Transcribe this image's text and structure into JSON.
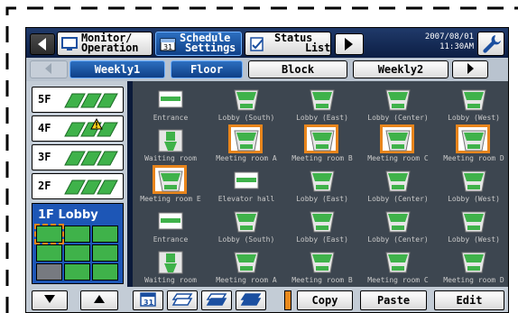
{
  "header": {
    "nav_left": "back",
    "buttons": [
      {
        "line1": "Monitor/",
        "line2": "Operation",
        "icon": "monitor-icon"
      },
      {
        "line1": "Schedule",
        "line2": "Settings",
        "icon": "calendar-icon"
      },
      {
        "line1": "Status",
        "line2": "List",
        "icon": "checklist-icon"
      }
    ],
    "date": "2007/08/01",
    "time": "11:30AM"
  },
  "tabs": [
    {
      "label": "Weekly1",
      "active": true
    },
    {
      "label": "Floor",
      "active": true
    },
    {
      "label": "Block",
      "active": false
    },
    {
      "label": "Weekly2",
      "active": false
    }
  ],
  "floors": [
    {
      "label": "5F",
      "warning": false
    },
    {
      "label": "4F",
      "warning": true
    },
    {
      "label": "3F",
      "warning": false
    },
    {
      "label": "2F",
      "warning": false
    },
    {
      "label": "1F Lobby",
      "selected": true
    }
  ],
  "units": [
    {
      "label": "Entrance",
      "kind": "flat",
      "selected": false
    },
    {
      "label": "Lobby (South)",
      "kind": "ceiling",
      "selected": false
    },
    {
      "label": "Lobby (East)",
      "kind": "ceiling",
      "selected": false
    },
    {
      "label": "Lobby (Center)",
      "kind": "ceiling",
      "selected": false
    },
    {
      "label": "Lobby (West)",
      "kind": "ceiling",
      "selected": false
    },
    {
      "label": "Waiting room",
      "kind": "wall",
      "selected": false
    },
    {
      "label": "Meeting room A",
      "kind": "ceiling",
      "selected": true
    },
    {
      "label": "Meeting room B",
      "kind": "ceiling",
      "selected": true
    },
    {
      "label": "Meeting room C",
      "kind": "ceiling",
      "selected": true
    },
    {
      "label": "Meeting room D",
      "kind": "ceiling",
      "selected": true
    },
    {
      "label": "Meeting room E",
      "kind": "ceiling",
      "selected": true
    },
    {
      "label": "Elevator hall",
      "kind": "flat",
      "selected": false
    },
    {
      "label": "Lobby (East)",
      "kind": "ceiling",
      "selected": false
    },
    {
      "label": "Lobby (Center)",
      "kind": "ceiling",
      "selected": false
    },
    {
      "label": "Lobby (West)",
      "kind": "ceiling",
      "selected": false
    },
    {
      "label": "Entrance",
      "kind": "flat",
      "selected": false
    },
    {
      "label": "Lobby (South)",
      "kind": "ceiling",
      "selected": false
    },
    {
      "label": "Lobby (East)",
      "kind": "ceiling",
      "selected": false
    },
    {
      "label": "Lobby (Center)",
      "kind": "ceiling",
      "selected": false
    },
    {
      "label": "Lobby (West)",
      "kind": "ceiling",
      "selected": false
    },
    {
      "label": "Waiting room",
      "kind": "wall",
      "selected": false
    },
    {
      "label": "Meeting room A",
      "kind": "ceiling",
      "selected": false
    },
    {
      "label": "Meeting room B",
      "kind": "ceiling",
      "selected": false
    },
    {
      "label": "Meeting room C",
      "kind": "ceiling",
      "selected": false
    },
    {
      "label": "Meeting room D",
      "kind": "ceiling",
      "selected": false
    }
  ],
  "footer": {
    "copy_label": "Copy",
    "paste_label": "Paste",
    "edit_label": "Edit",
    "calendar_day": "31"
  },
  "colors": {
    "accent_blue": "#1d56b6",
    "selection_orange": "#e8851c",
    "unit_green": "#3fb24a",
    "panel_dark": "#0b1a3a"
  }
}
